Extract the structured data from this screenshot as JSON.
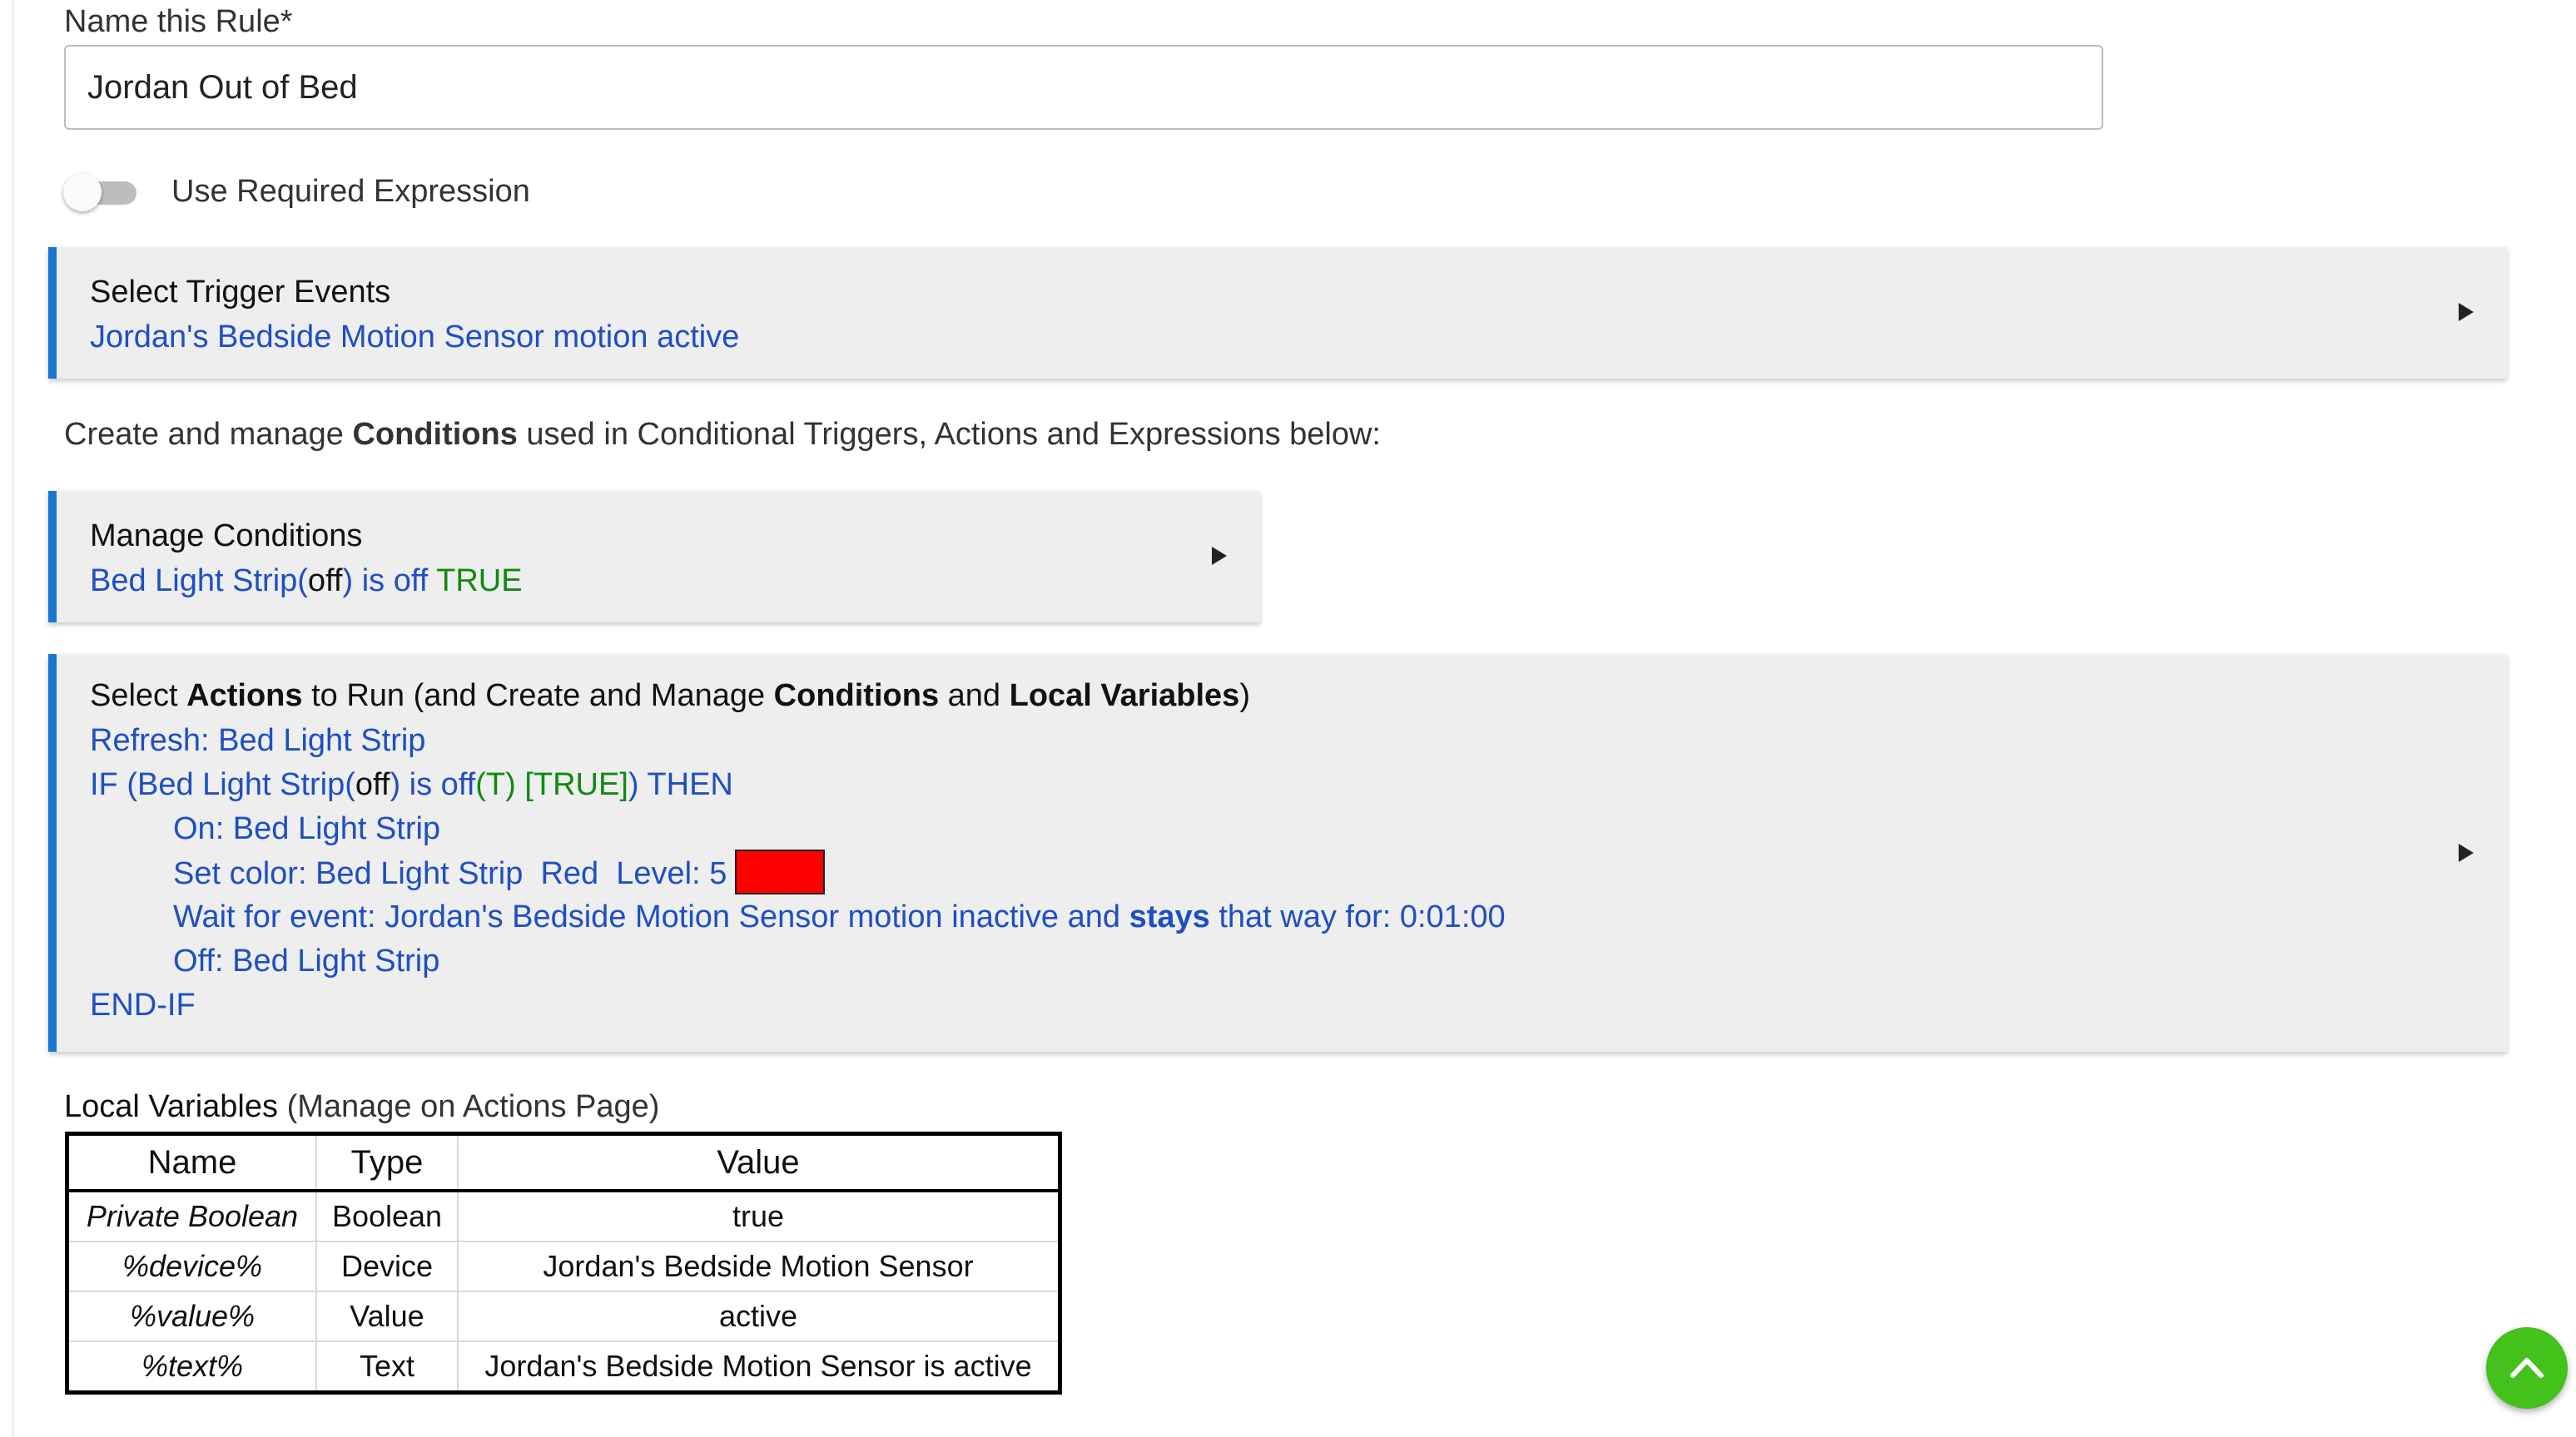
{
  "form": {
    "name_label": "Name this Rule*",
    "name_value": "Jordan Out of Bed",
    "toggle_label": "Use Required Expression",
    "toggle_on": false
  },
  "trigger": {
    "title": "Select Trigger Events",
    "summary": "Jordan's Bedside Motion Sensor motion active"
  },
  "conditions_intro": {
    "pre": "Create and manage ",
    "bold": "Conditions",
    "post": " used in Conditional Triggers, Actions and Expressions below:"
  },
  "conditions": {
    "title": "Manage Conditions",
    "device": "Bed Light Strip(",
    "state": "off",
    "mid": ") is off ",
    "result": "TRUE"
  },
  "actions": {
    "title_pre": "Select ",
    "title_b1": "Actions",
    "title_mid1": " to Run (and Create and Manage ",
    "title_b2": "Conditions",
    "title_mid2": " and ",
    "title_b3": "Local Variables",
    "title_post": ")",
    "refresh": "Refresh: Bed Light Strip",
    "if_pre": "IF (Bed Light Strip(",
    "if_state": "off",
    "if_mid": ") is off",
    "if_t": "(T) [TRUE]",
    "if_post": ") THEN",
    "on": "On: Bed Light Strip",
    "set_color": "Set color: Bed Light Strip  Red  Level: 5",
    "swatch_color": "#ff0000",
    "wait_pre": "Wait for event: Jordan's Bedside Motion Sensor motion inactive and ",
    "wait_bold": "stays",
    "wait_post": " that way for: 0:01:00",
    "off": "Off: Bed Light Strip",
    "end_if": "END-IF"
  },
  "local_vars": {
    "label": "Local Variables",
    "label_suffix": " (Manage on Actions Page)",
    "headers": [
      "Name",
      "Type",
      "Value"
    ],
    "rows": [
      {
        "name": "Private Boolean",
        "type": "Boolean",
        "value": "true"
      },
      {
        "name": "%device%",
        "type": "Device",
        "value": "Jordan's Bedside Motion Sensor"
      },
      {
        "name": "%value%",
        "type": "Value",
        "value": "active"
      },
      {
        "name": "%text%",
        "type": "Text",
        "value": "Jordan's Bedside Motion Sensor is active"
      }
    ]
  },
  "colors": {
    "accent": "#1976d2",
    "link": "#1e4fc2",
    "true_green": "#0f8a0f",
    "fab": "#44c11b"
  },
  "icons": {
    "expand": "triangle-right-icon",
    "scroll_top": "chevron-up-icon"
  }
}
